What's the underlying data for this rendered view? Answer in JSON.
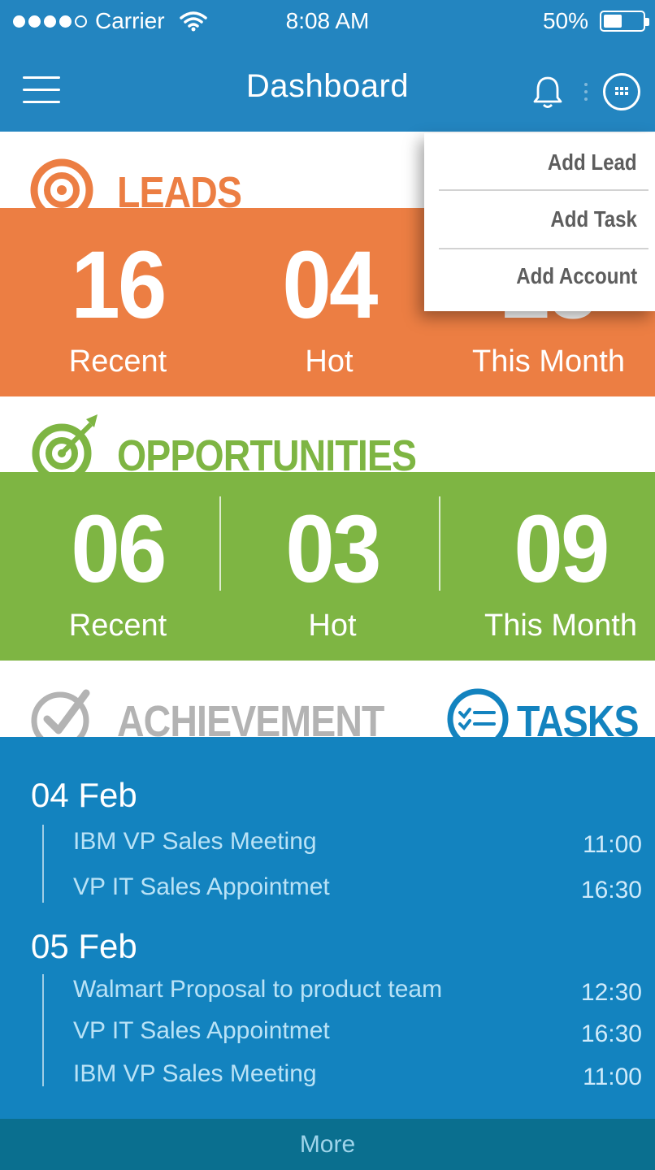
{
  "status_bar": {
    "carrier": "Carrier",
    "time": "8:08 AM",
    "battery": "50%"
  },
  "header": {
    "title": "Dashboard"
  },
  "leads": {
    "title": "LEADS",
    "color": "#ec7e43",
    "stats": [
      {
        "value": "16",
        "label": "Recent"
      },
      {
        "value": "04",
        "label": "Hot"
      },
      {
        "value": "23",
        "label": "This Month"
      }
    ]
  },
  "opportunities": {
    "title": "OPPORTUNITIES",
    "color": "#7eb543",
    "stats": [
      {
        "value": "06",
        "label": "Recent"
      },
      {
        "value": "03",
        "label": "Hot"
      },
      {
        "value": "09",
        "label": "This Month"
      }
    ]
  },
  "tabs": {
    "achievement": "ACHIEVEMENT",
    "tasks": "TASKS"
  },
  "task_days": [
    {
      "date": "04 Feb",
      "items": [
        {
          "title": "IBM VP Sales Meeting",
          "time": "11:00"
        },
        {
          "title": "VP IT Sales Appointmet",
          "time": "16:30"
        }
      ]
    },
    {
      "date": "05 Feb",
      "items": [
        {
          "title": "Walmart Proposal to product team",
          "time": "12:30"
        },
        {
          "title": "VP IT Sales Appointmet",
          "time": "16:30"
        },
        {
          "title": "IBM VP Sales Meeting",
          "time": "11:00"
        }
      ]
    }
  ],
  "more_label": "More",
  "dropdown": {
    "items": [
      "Add Lead",
      "Add Task",
      "Add Account"
    ]
  }
}
